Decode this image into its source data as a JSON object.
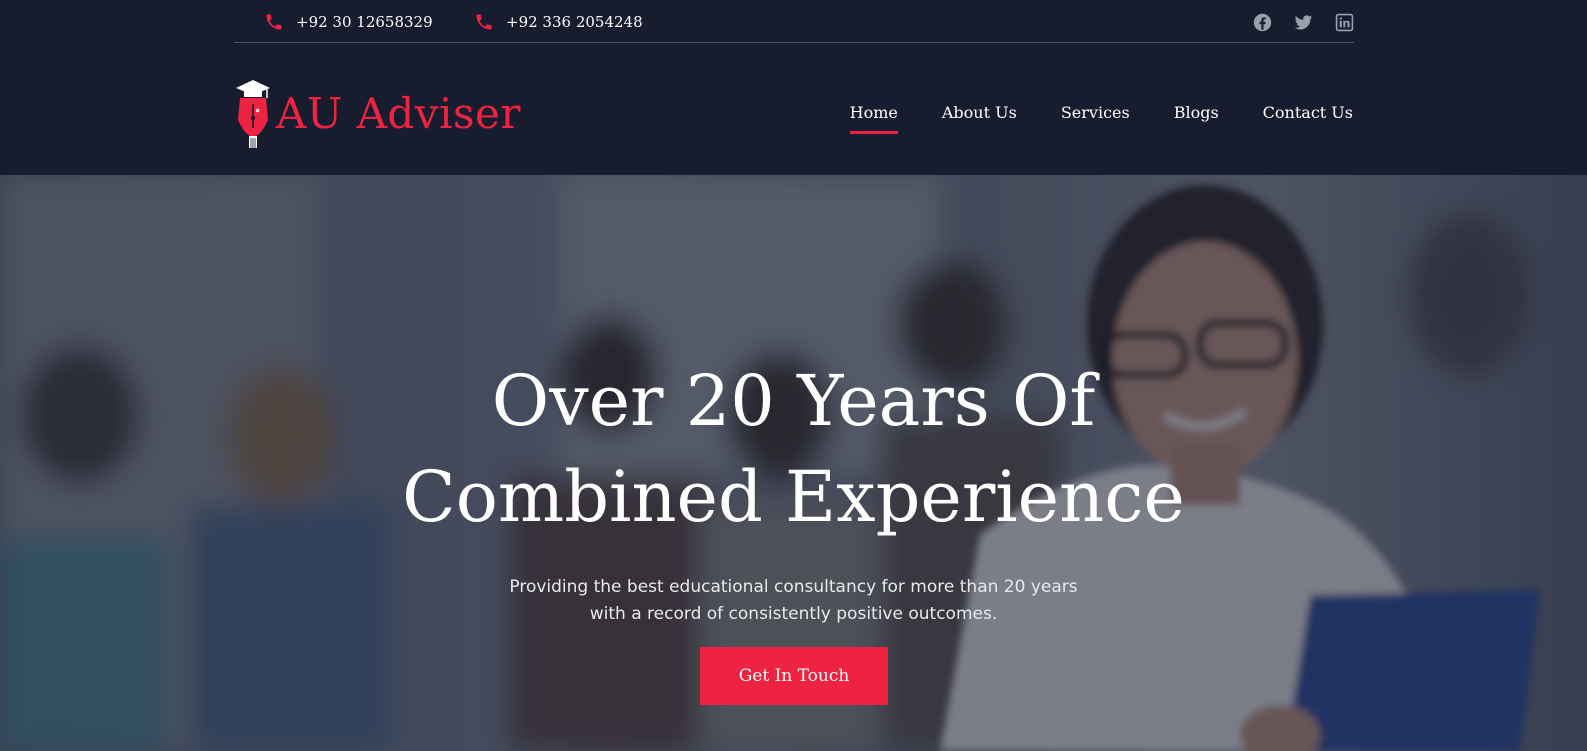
{
  "topbar": {
    "phones": [
      {
        "number": "+92 30 12658329",
        "icon": "phone-icon"
      },
      {
        "number": "+92 336 2054248",
        "icon": "phone-icon"
      }
    ],
    "socials": [
      {
        "name": "facebook-icon"
      },
      {
        "name": "twitter-icon"
      },
      {
        "name": "linkedin-icon"
      }
    ]
  },
  "header": {
    "logo_text": "AU Adviser",
    "nav": [
      {
        "label": "Home",
        "active": true
      },
      {
        "label": "About Us",
        "active": false
      },
      {
        "label": "Services",
        "active": false
      },
      {
        "label": "Blogs",
        "active": false
      },
      {
        "label": "Contact Us",
        "active": false
      }
    ]
  },
  "hero": {
    "title_line1": "Over 20 Years Of",
    "title_line2": "Combined Experience",
    "subtitle_line1": "Providing the best educational consultancy for more than 20 years",
    "subtitle_line2": "with a record of consistently positive outcomes.",
    "cta_label": "Get In Touch"
  },
  "colors": {
    "background": "#171d2e",
    "accent": "#ee2341",
    "text": "#ffffff",
    "social_icon": "#9aa0ab"
  }
}
